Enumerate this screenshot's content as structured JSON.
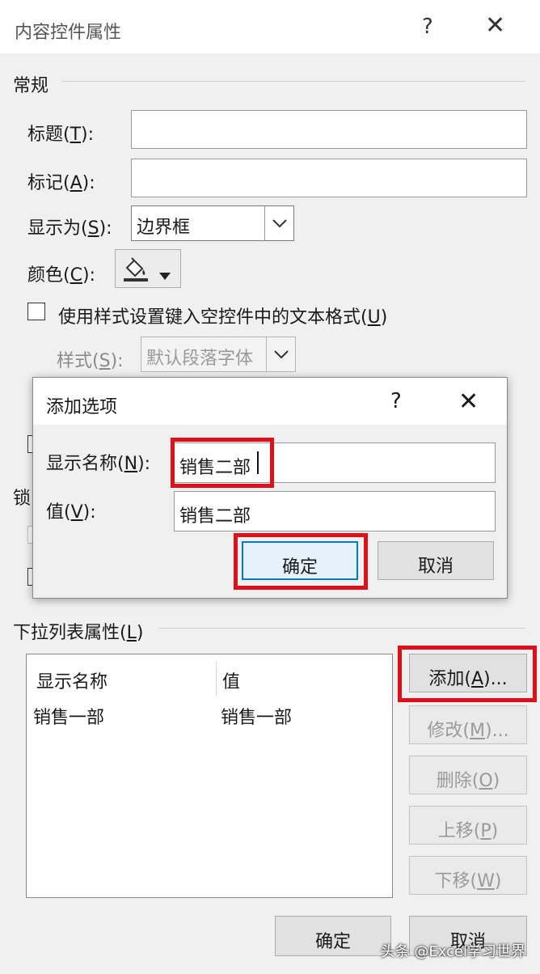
{
  "dialog": {
    "title": "内容控件属性",
    "help_glyph": "?",
    "close_glyph": "✕"
  },
  "general": {
    "group_label": "常规",
    "title_label_pre": "标题(",
    "title_label_key": "T",
    "title_label_post": "):",
    "title_value": "",
    "tag_label_pre": "标记(",
    "tag_label_key": "A",
    "tag_label_post": "):",
    "tag_value": "",
    "show_as_label_pre": "显示为(",
    "show_as_label_key": "S",
    "show_as_label_post": "):",
    "show_as_value": "边界框",
    "color_label_pre": "颜色(",
    "color_label_key": "C",
    "color_label_post": "):",
    "use_style_label_pre": "使用样式设置键入空控件中的文本格式(",
    "use_style_label_key": "U",
    "use_style_label_post": ")",
    "use_style_checked": false,
    "style_label_pre": "样式(",
    "style_label_key": "S",
    "style_label_post": "):",
    "style_value": "默认段落字体"
  },
  "lock_partial": {
    "label_fragment": "锁"
  },
  "dropdown": {
    "group_label_pre": "下拉列表属性(",
    "group_label_key": "L",
    "group_label_post": ")",
    "columns": [
      "显示名称",
      "值"
    ],
    "rows": [
      {
        "display": "销售一部",
        "value": "销售一部"
      }
    ],
    "add_pre": "添加(",
    "add_key": "A",
    "add_post": ")...",
    "modify_pre": "修改(",
    "modify_key": "M",
    "modify_post": ")...",
    "delete_pre": "删除(",
    "delete_key": "O",
    "delete_post": ")",
    "up_pre": "上移(",
    "up_key": "P",
    "up_post": ")",
    "down_pre": "下移(",
    "down_key": "W",
    "down_post": ")"
  },
  "footer": {
    "ok_label": "确定",
    "cancel_label": "取消"
  },
  "add_option_modal": {
    "title": "添加选项",
    "help_glyph": "?",
    "close_glyph": "✕",
    "display_label_pre": "显示名称(",
    "display_label_key": "N",
    "display_label_post": "):",
    "display_value": "销售二部",
    "value_label_pre": "值(",
    "value_label_key": "V",
    "value_label_post": "):",
    "value_value": "销售二部",
    "ok_label": "确定",
    "cancel_label": "取消"
  },
  "watermark": "头条 @Excel学习世界",
  "colors": {
    "highlight_red": "#e0101a",
    "focus_blue": "#0078d7"
  }
}
